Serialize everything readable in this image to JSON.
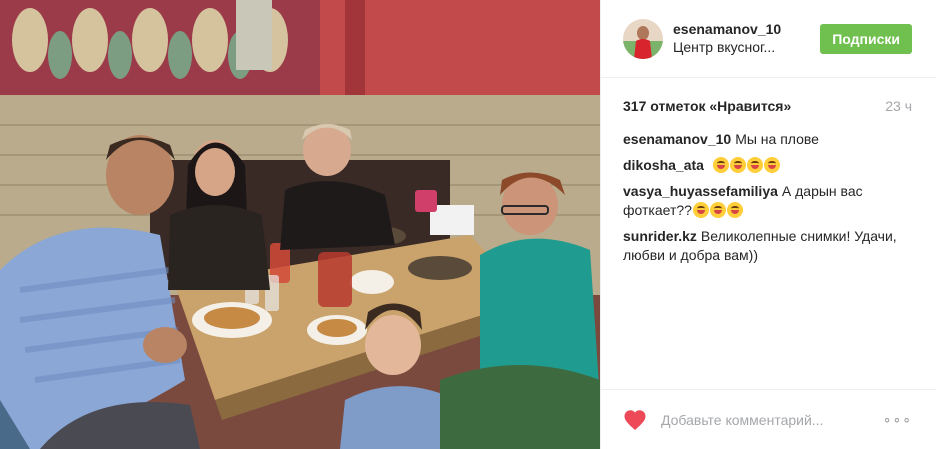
{
  "post": {
    "username": "esenamanov_10",
    "location": "Центр вкусног...",
    "follow_label": "Подписки",
    "likes": "317 отметок «Нравится»",
    "time_ago": "23 ч",
    "comments": [
      {
        "user": "esenamanov_10",
        "text": "Мы на плове",
        "emoji": []
      },
      {
        "user": "dikosha_ata",
        "text": "",
        "emoji": [
          "face-savoring-food",
          "face-savoring-food",
          "face-savoring-food",
          "face-savoring-food"
        ]
      },
      {
        "user": "vasya_huyassefamiliya",
        "text": "А дарын вас фоткает??",
        "emoji": [
          "grinning-sweat-face",
          "grinning-sweat-face",
          "grinning-sweat-face"
        ]
      },
      {
        "user": "sunrider.kz",
        "text": "Великолепные снимки! Удачи, любви и добра вам))",
        "emoji": []
      }
    ],
    "comment_placeholder": "Добавьте комментарий...",
    "more_label": "∘∘∘",
    "colors": {
      "follow": "#70c050",
      "heart": "#ed4956",
      "muted": "#a5a7aa"
    }
  }
}
